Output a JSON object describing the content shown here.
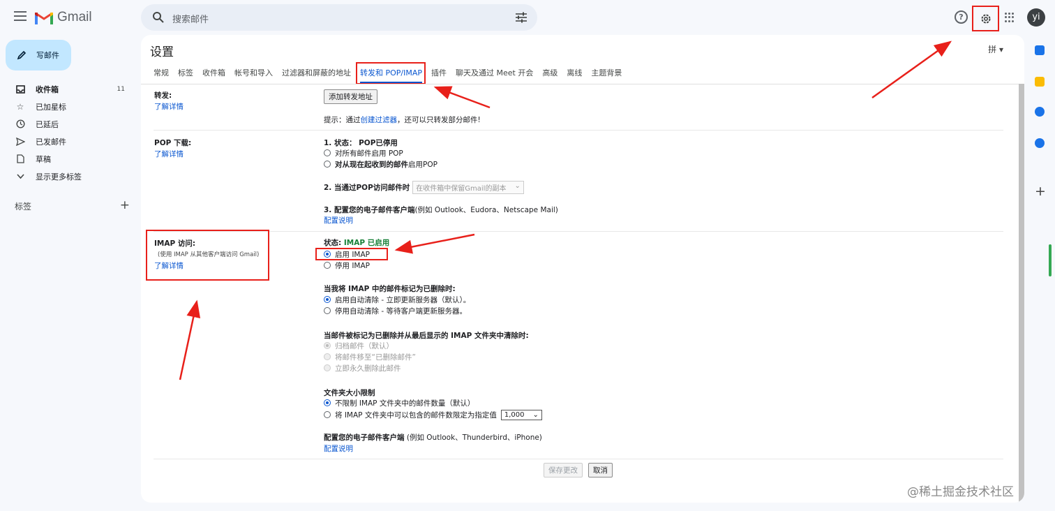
{
  "header": {
    "app_name": "Gmail",
    "search_placeholder": "搜索邮件",
    "help": "?",
    "avatar_initials": "yi"
  },
  "sidebar": {
    "compose": "写邮件",
    "items": [
      {
        "label": "收件箱",
        "count": "11"
      },
      {
        "label": "已加星标"
      },
      {
        "label": "已延后"
      },
      {
        "label": "已发邮件"
      },
      {
        "label": "草稿"
      },
      {
        "label": "显示更多标签"
      }
    ],
    "labels_heading": "标签",
    "add": "+"
  },
  "settings": {
    "title": "设置",
    "lang": "拼 ▾",
    "tabs": [
      "常规",
      "标签",
      "收件箱",
      "帐号和导入",
      "过滤器和屏蔽的地址",
      "转发和 POP/IMAP",
      "插件",
      "聊天及通过 Meet 开会",
      "高级",
      "离线",
      "主题背景"
    ],
    "learn_more": "了解详情",
    "forward": {
      "label": "转发:",
      "button": "添加转发地址",
      "tip_prefix": "提示：通过",
      "tip_link": "创建过滤器",
      "tip_suffix": "，还可以只转发部分邮件!"
    },
    "pop": {
      "label": "POP 下载:",
      "status_prefix": "1. 状态：",
      "status_value": "POP已停用",
      "opt1": "对所有邮件启用 POP",
      "opt2_bold": "对从现在起收到的邮件",
      "opt2_rest": "启用POP",
      "step2": "2. 当通过POP访问邮件时",
      "step2_select": "在收件箱中保留Gmail的副本",
      "step3": "3. 配置您的电子邮件客户端",
      "step3_rest": "(例如 Outlook、Eudora、Netscape Mail)",
      "config_link": "配置说明"
    },
    "imap": {
      "label": "IMAP 访问:",
      "sub": "(使用 IMAP 从其他客户端访问 Gmail)",
      "status_prefix": "状态: ",
      "status_value": "IMAP 已启用",
      "enable": "启用 IMAP",
      "disable": "停用 IMAP",
      "delete_heading": "当我将 IMAP 中的邮件标记为已删除时:",
      "auto_on": "启用自动清除 - 立即更新服务器（默认）。",
      "auto_off": "停用自动清除 - 等待客户端更新服务器。",
      "expunge_heading": "当邮件被标记为已删除并从最后显示的 IMAP 文件夹中清除时:",
      "archive": "归档邮件（默认）",
      "trash": "将邮件移至“已删除邮件”",
      "delete_forever": "立即永久删除此邮件",
      "folder_heading": "文件夹大小限制",
      "no_limit": "不限制 IMAP 文件夹中的邮件数量（默认）",
      "limit": "将 IMAP 文件夹中可以包含的邮件数限定为指定值",
      "limit_value": "1,000",
      "client_bold": "配置您的电子邮件客户端",
      "client_rest": "(例如 Outlook、Thunderbird、iPhone)",
      "config_link": "配置说明"
    },
    "save": "保存更改",
    "cancel": "取消"
  },
  "watermark": "@稀土掘金技术社区",
  "colors": {
    "accent": "#0b57d0",
    "highlight": "#e8201a",
    "enabled": "#188038"
  }
}
